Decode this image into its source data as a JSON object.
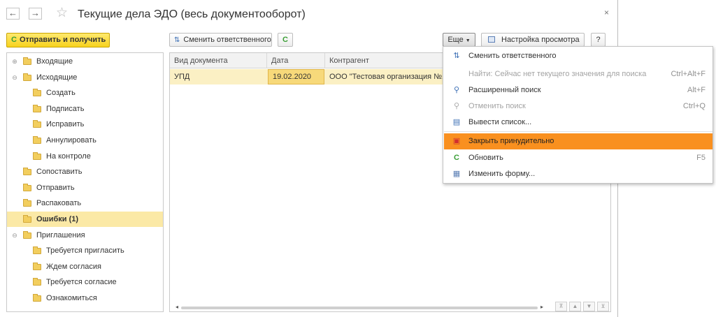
{
  "window": {
    "title": "Текущие дела ЭДО (весь документооборот)",
    "back_label": "←",
    "forward_label": "→",
    "star_glyph": "☆",
    "close_glyph": "×"
  },
  "toolbar": {
    "send_receive_label": "Отправить и получить",
    "change_responsible_label": "Сменить ответственного",
    "more_label": "Еще",
    "view_settings_label": "Настройка просмотра",
    "help_label": "?"
  },
  "tree": {
    "items": [
      {
        "label": "Входящие",
        "expander": "⊕"
      },
      {
        "label": "Исходящие",
        "expander": "⊖"
      },
      {
        "label": "Создать"
      },
      {
        "label": "Подписать"
      },
      {
        "label": "Исправить"
      },
      {
        "label": "Аннулировать"
      },
      {
        "label": "На контроле"
      },
      {
        "label": "Сопоставить"
      },
      {
        "label": "Отправить"
      },
      {
        "label": "Распаковать"
      },
      {
        "label": "Ошибки (1)"
      },
      {
        "label": "Приглашения",
        "expander": "⊖"
      },
      {
        "label": "Требуется пригласить"
      },
      {
        "label": "Ждем согласия"
      },
      {
        "label": "Требуется согласие"
      },
      {
        "label": "Ознакомиться"
      }
    ]
  },
  "table": {
    "columns": [
      "Вид документа",
      "Дата",
      "Контрагент"
    ],
    "rows": [
      [
        "УПД",
        "19.02.2020",
        "ООО \"Тестовая организация №1\""
      ]
    ]
  },
  "context_menu": {
    "items": [
      {
        "label": "Сменить ответственного",
        "icon": "change-responsible-icon",
        "shortcut": ""
      },
      {
        "label": "Найти: Сейчас нет текущего значения для поиска",
        "icon": "",
        "shortcut": "Ctrl+Alt+F"
      },
      {
        "label": "Расширенный поиск",
        "icon": "search-icon",
        "shortcut": "Alt+F"
      },
      {
        "label": "Отменить поиск",
        "icon": "cancel-search-icon",
        "shortcut": "Ctrl+Q"
      },
      {
        "label": "Вывести список...",
        "icon": "print-list-icon",
        "shortcut": ""
      },
      {
        "label": "Закрыть принудительно",
        "icon": "force-close-icon",
        "shortcut": ""
      },
      {
        "label": "Обновить",
        "icon": "refresh-icon",
        "shortcut": "F5"
      },
      {
        "label": "Изменить форму...",
        "icon": "edit-form-icon",
        "shortcut": ""
      }
    ]
  },
  "colors": {
    "accent_yellow": "#f7d21e",
    "selected_row": "#fbf0c4",
    "menu_highlight": "#f9901f",
    "refresh_green": "#3a9e35"
  }
}
